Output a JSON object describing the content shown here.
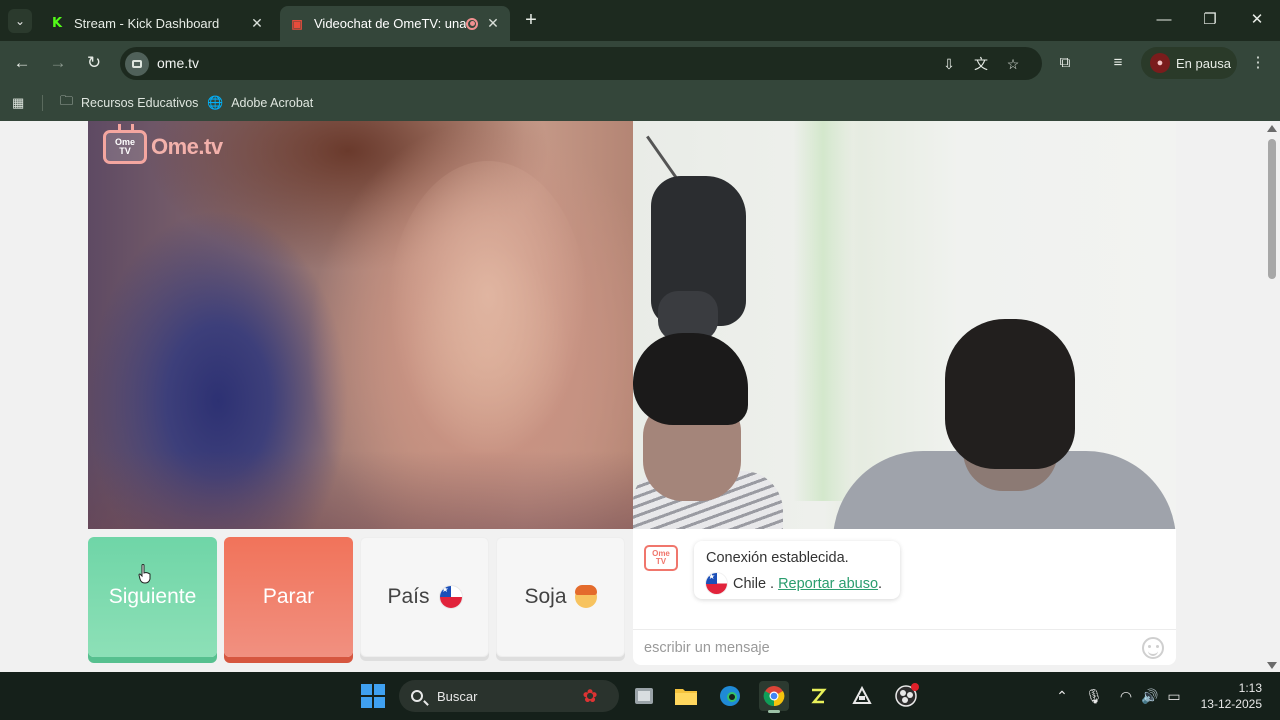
{
  "browser": {
    "tabs": [
      {
        "title": "Stream - Kick Dashboard",
        "active": false
      },
      {
        "title": "Videochat de OmeTV: una a",
        "active": true
      }
    ],
    "url": "ome.tv",
    "profile_label": "En pausa",
    "bookmarks": [
      {
        "label": "Recursos Educativos",
        "icon": "folder-icon"
      },
      {
        "label": "Adobe Acrobat",
        "icon": "globe-icon"
      }
    ]
  },
  "page": {
    "logo": {
      "badge_line1": "Ome",
      "badge_line2": "TV",
      "word": "Ome.tv"
    },
    "buttons": {
      "next": "Siguiente",
      "stop": "Parar",
      "country": "País",
      "gender": "Soja"
    },
    "chat": {
      "logo_line1": "Ome",
      "logo_line2": "TV",
      "status": "Conexión establecida.",
      "country": "Chile",
      "separator": ".",
      "report_link": "Reportar abuso",
      "report_suffix": ".",
      "input_placeholder": "escribir un mensaje"
    }
  },
  "taskbar": {
    "search_label": "Buscar",
    "time": "1:13",
    "date": "13-12-2025"
  },
  "colors": {
    "next_button": "#6fd5a7",
    "stop_button": "#f1735a",
    "report_link": "#2a9d6e",
    "chrome_dark": "#1d2a1f",
    "chrome_toolbar": "#34463a"
  }
}
